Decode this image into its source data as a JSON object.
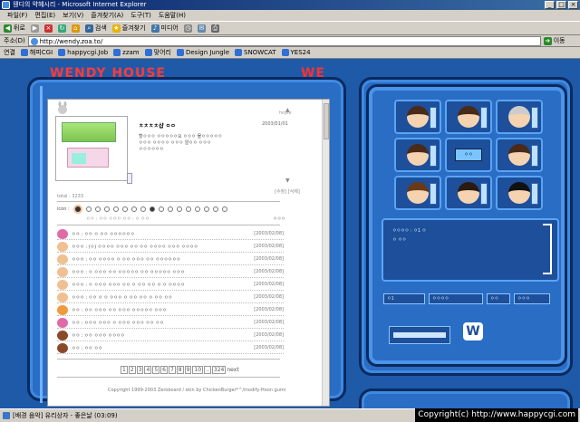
{
  "window": {
    "title": "웬디의 약혜시리 - Microsoft Internet Explorer"
  },
  "menu": [
    "파일(F)",
    "편집(E)",
    "보기(V)",
    "즐겨찾기(A)",
    "도구(T)",
    "도움말(H)"
  ],
  "toolbar": {
    "back": "뒤로",
    "search": "검색",
    "favorites": "즐겨찾기",
    "media": "미디어"
  },
  "address": {
    "label": "주소(D)",
    "url": "http://wendy.zoa.to/",
    "go": "이동"
  },
  "links": {
    "label": "연결",
    "items": [
      "해피CGI",
      "happycgi.Job",
      "zzam",
      "맞어리",
      "Design Jungle",
      "SNOWCAT",
      "YES24"
    ]
  },
  "site": {
    "logo": "WENDY HOUSE",
    "logo2": "WE"
  },
  "board": {
    "post_name": "hoyle",
    "post_title": "ㅊㅊㅊㅊ샵 ㅇㅇ",
    "post_date": "2003/01/01",
    "post_body": "할ㅇㅇㅇ ㅇㅇㅇㅇㅇ요 ㅇㅇㅇ 물ㅇㅇㅇㅇㅇ\nㅇㅇㅇ ㅇㅇㅇㅇ ㅇㅇㅇ 알ㅇㅇ ㅇㅇㅇ\nㅇㅇㅇㅇㅇㅇ",
    "total": "total : 3233",
    "read_more": "[수정] [삭제]",
    "icon_label": "icon :",
    "form_text": "ㅇㅇ : ㅇㅇ ㅇㅇㅇ ㅇㅇ : ㅇ ㅇㅇ",
    "form_btn": "ㅇㅇㅇ",
    "comments": [
      {
        "text": "ㅇㅇ : ㅇㅇ ㅇ ㅇㅇ ㅇㅇㅇㅇㅇㅇ",
        "date": "[2003/02/08]"
      },
      {
        "text": "ㅇㅇㅇ : (ㅇ) ㅇㅇㅇㅇ ㅇㅇㅇ ㅇㅇ ㅇㅇ ㅇㅇㅇㅇ ㅇㅇㅇ ㅇㅇㅇㅇ",
        "date": "[2003/02/08]"
      },
      {
        "text": "ㅇㅇㅇ : ㅇㅇ ㅇㅇㅇㅇ ㅇ ㅇㅇ ㅇㅇㅇ ㅇㅇ ㅇㅇㅇㅇㅇㅇ",
        "date": "[2003/02/08]"
      },
      {
        "text": "ㅇㅇㅇ : ㅇ ㅇㅇㅇ ㅇㅇ ㅇㅇㅇㅇㅇ ㅇㅇ ㅇㅇㅇㅇㅇ ㅇㅇㅇ",
        "date": "[2003/02/08]"
      },
      {
        "text": "ㅇㅇㅇ : ㅇ ㅇㅇㅇ ㅇㅇㅇ ㅇㅇ ㅇ ㅇㅇ ㅇㅇ ㅇ ㅇ ㅇㅇㅇㅇ",
        "date": "[2003/02/08]"
      },
      {
        "text": "ㅇㅇㅇ : ㅇㅇ ㅇ ㅇ ㅇㅇㅇ ㅇ ㅇㅇ ㅇㅇ ㅇ ㅇㅇ ㅇㅇ",
        "date": "[2003/02/08]"
      },
      {
        "text": "ㅇㅇ : ㅇㅇ ㅇㅇㅇ ㅇㅇ ㅇㅇㅇ ㅇㅇㅇㅇㅇ ㅇㅇㅇ",
        "date": "[2003/02/08]"
      },
      {
        "text": "ㅇㅇ : ㅇㅇㅇ ㅇㅇㅇ ㅇ ㅇㅇㅇ ㅇㅇㅇ ㅇㅇ ㅇㅇ",
        "date": "[2003/02/08]"
      },
      {
        "text": "ㅇㅇ : ㅇㅇ ㅇㅇㅇ ㅇㅇㅇㅇ",
        "date": "[2003/02/08]"
      },
      {
        "text": "ㅇㅇ : ㅇㅇ ㅇㅇ",
        "date": "[2003/02/08]"
      }
    ],
    "pager": [
      "1",
      "2",
      "3",
      "4",
      "5",
      "6",
      "7",
      "8",
      "9",
      "10",
      "..",
      "324"
    ],
    "pager_next": "next",
    "copyright": "Copyright 1999-2003 Zeroboard / skin by ChickenBurger*^/modify-Hoon gumi"
  },
  "right": {
    "center_btn": "ㅇㅇ",
    "info1": "ㅇㅇㅇㅇ : ㅇ1 ㅇ",
    "info2": "ㅇ ㅇㅇ",
    "status1": "ㅇ1",
    "status2": "ㅇㅇㅇㅇ",
    "status3": "ㅇㅇ",
    "status4": "ㅇㅇㅇ",
    "wlogo": "W"
  },
  "statusbar": {
    "text": "[배경 음악] 유리상자 - 좋은날 (03:09)"
  },
  "watermark": "Copyright(c) http://www.happycgi.com"
}
